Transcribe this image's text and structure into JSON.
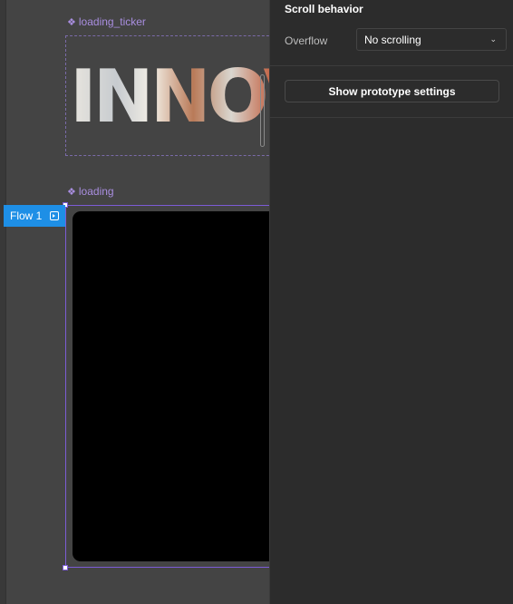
{
  "canvas": {
    "ticker_label": "loading_ticker",
    "ticker_text": "INNOVA",
    "loading_label": "loading",
    "flow_tag": "Flow 1"
  },
  "panel": {
    "section_title": "Scroll behavior",
    "overflow_label": "Overflow",
    "overflow_value": "No scrolling",
    "prototype_button": "Show prototype settings"
  },
  "icons": {
    "component": "component-diamond-icon",
    "flow": "flow-start-icon",
    "chevron": "chevron-down-icon"
  },
  "colors": {
    "canvas_bg": "#444444",
    "panel_bg": "#2c2c2c",
    "component_purple": "#a98ee0",
    "selection_purple": "#7c5cd6",
    "flow_blue": "#1e8fe6"
  }
}
